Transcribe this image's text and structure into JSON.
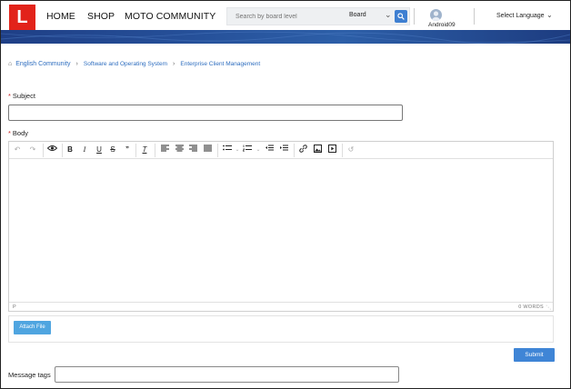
{
  "header": {
    "logo_letter": "L",
    "nav": [
      "HOME",
      "SHOP",
      "MOTO COMMUNITY"
    ],
    "search": {
      "placeholder": "Search by board level",
      "scope": "Board"
    },
    "username": "Android09",
    "language": "Select Language"
  },
  "breadcrumb": [
    "English Community",
    "Software and Operating System",
    "Enterprise Client Management"
  ],
  "form": {
    "subject_label": "Subject",
    "subject_value": "",
    "body_label": "Body",
    "body_value": "",
    "status_path": "P",
    "word_count": "0 WORDS",
    "attach_label": "Attach File",
    "submit_label": "Submit",
    "tags_label": "Message tags",
    "tags_value": ""
  },
  "toolbar_icons": [
    "undo-icon",
    "redo-icon",
    "preview-eye-icon",
    "bold-icon",
    "italic-icon",
    "underline-icon",
    "strikethrough-icon",
    "blockquote-icon",
    "clear-formatting-icon",
    "align-left-icon",
    "align-center-icon",
    "align-right-icon",
    "justify-icon",
    "bullet-list-icon",
    "numbered-list-icon",
    "outdent-icon",
    "indent-icon",
    "link-icon",
    "image-icon",
    "video-icon",
    "history-icon"
  ],
  "colors": {
    "brand_red": "#e2231a",
    "link_blue": "#2d6dbf",
    "button_blue": "#3f85d6",
    "attach_blue": "#4fa5e0",
    "banner_blue": "#26519a"
  }
}
